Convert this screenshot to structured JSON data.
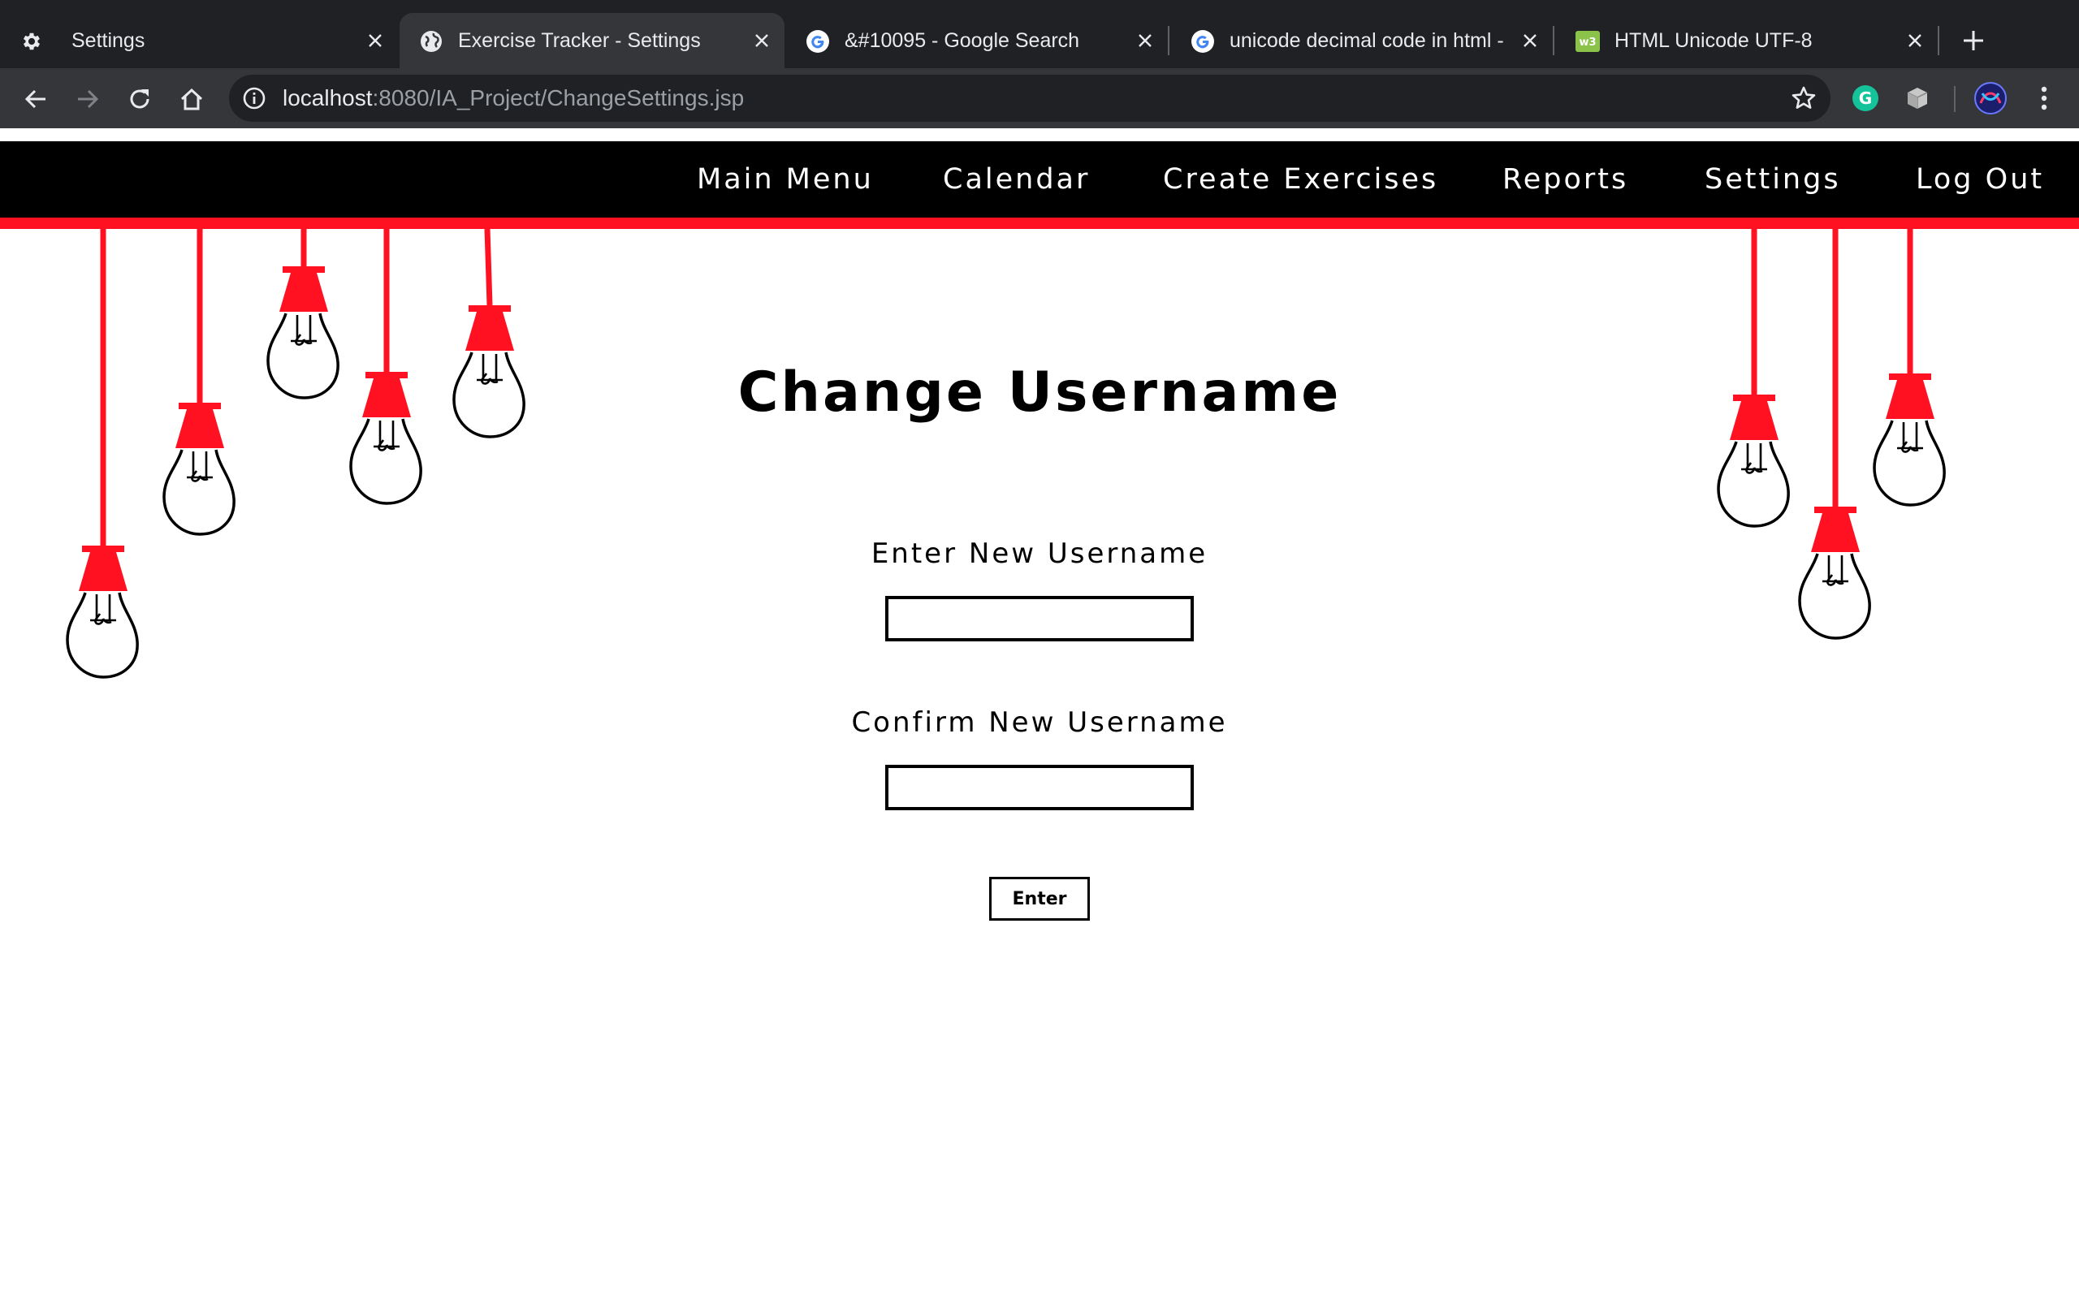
{
  "browser": {
    "tabs": [
      {
        "title": "Settings",
        "icon": "gear-icon"
      },
      {
        "title": "Exercise Tracker - Settings",
        "icon": "globe-icon"
      },
      {
        "title": "&#10095 - Google Search",
        "icon": "google-icon"
      },
      {
        "title": "unicode decimal code in html - G",
        "icon": "google-icon"
      },
      {
        "title": "HTML Unicode UTF-8",
        "icon": "w3schools-icon"
      }
    ],
    "url_host": "localhost",
    "url_path": ":8080/IA_Project/ChangeSettings.jsp"
  },
  "nav": {
    "items": [
      "Main Menu",
      "Calendar",
      "Create Exercises",
      "Reports",
      "Settings",
      "Log Out"
    ]
  },
  "form": {
    "heading": "Change Username",
    "new_label": "Enter New Username",
    "new_value": "",
    "confirm_label": "Confirm New Username",
    "confirm_value": "",
    "submit_label": "Enter"
  },
  "colors": {
    "accent": "#ff1121",
    "nav_bg": "#000000",
    "chrome_bg": "#202124",
    "chrome_active": "#35363a"
  }
}
